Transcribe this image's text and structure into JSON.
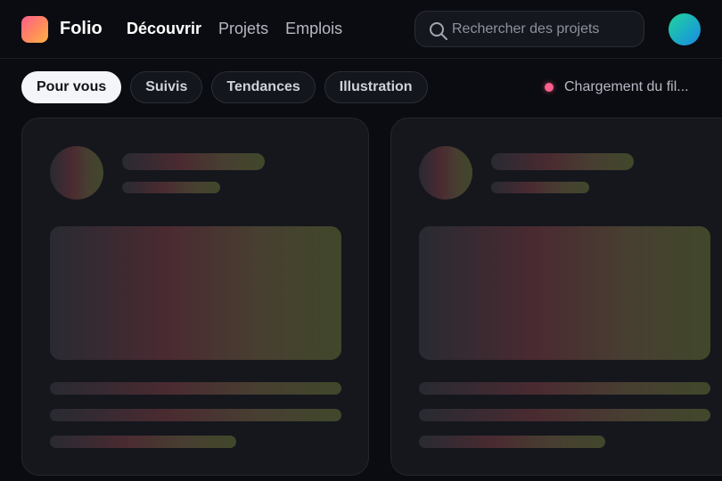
{
  "brand": {
    "name": "Folio"
  },
  "nav": {
    "items": [
      {
        "label": "Découvrir",
        "active": true
      },
      {
        "label": "Projets",
        "active": false
      },
      {
        "label": "Emplois",
        "active": false
      }
    ]
  },
  "search": {
    "placeholder": "Rechercher des projets",
    "value": ""
  },
  "filters": {
    "chips": [
      {
        "label": "Pour vous",
        "active": true
      },
      {
        "label": "Suivis",
        "active": false
      },
      {
        "label": "Tendances",
        "active": false
      },
      {
        "label": "Illustration",
        "active": false
      }
    ]
  },
  "status": {
    "text": "Chargement du fil...",
    "dot_color": "#ff5f8d"
  },
  "icons": {
    "search": "search-icon"
  },
  "colors": {
    "background": "#0b0c11",
    "card": "#15171d",
    "active_chip": "#f4f5f8",
    "logo_gradient": [
      "#ff5f8d",
      "#ffb347"
    ],
    "avatar_gradient": [
      "#22d39a",
      "#1d87e0"
    ]
  }
}
